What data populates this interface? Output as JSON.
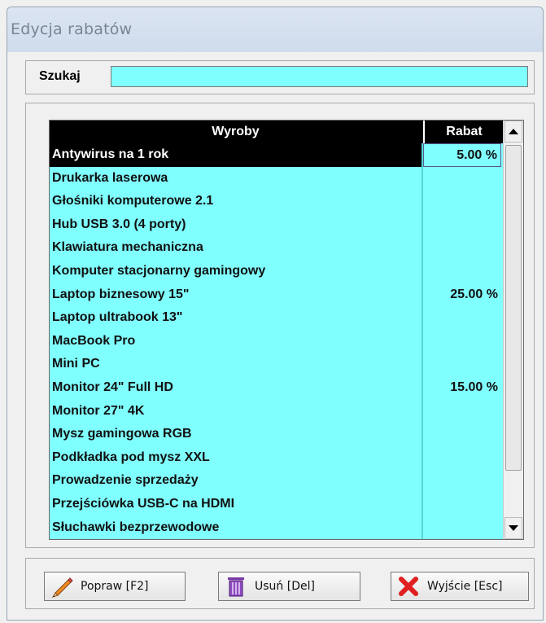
{
  "window": {
    "title": "Edycja rabatów"
  },
  "search": {
    "label": "Szukaj",
    "value": "",
    "placeholder": ""
  },
  "grid": {
    "columns": {
      "name": "Wyroby",
      "discount": "Rabat"
    },
    "selected_index": 0,
    "rows": [
      {
        "name": "Antywirus na 1 rok",
        "discount": "5.00 %"
      },
      {
        "name": "Drukarka laserowa",
        "discount": ""
      },
      {
        "name": "Głośniki komputerowe 2.1",
        "discount": ""
      },
      {
        "name": "Hub USB 3.0 (4 porty)",
        "discount": ""
      },
      {
        "name": "Klawiatura mechaniczna",
        "discount": ""
      },
      {
        "name": "Komputer stacjonarny gamingowy",
        "discount": ""
      },
      {
        "name": "Laptop biznesowy 15\"",
        "discount": "25.00 %"
      },
      {
        "name": "Laptop ultrabook 13\"",
        "discount": ""
      },
      {
        "name": "MacBook Pro",
        "discount": ""
      },
      {
        "name": "Mini PC",
        "discount": ""
      },
      {
        "name": "Monitor 24\" Full HD",
        "discount": "15.00 %"
      },
      {
        "name": "Monitor 27\" 4K",
        "discount": ""
      },
      {
        "name": "Mysz gamingowa RGB",
        "discount": ""
      },
      {
        "name": "Podkładka pod mysz XXL",
        "discount": ""
      },
      {
        "name": "Prowadzenie sprzedaży",
        "discount": ""
      },
      {
        "name": "Przejściówka USB-C na HDMI",
        "discount": ""
      },
      {
        "name": "Słuchawki bezprzewodowe",
        "discount": ""
      }
    ]
  },
  "buttons": {
    "edit": {
      "label": "Popraw   [F2]",
      "icon": "pencil-icon"
    },
    "delete": {
      "label": "Usuń   [Del]",
      "icon": "trash-icon"
    },
    "exit": {
      "label": "Wyjście  [Esc]",
      "icon": "red-x-icon"
    }
  },
  "colors": {
    "field_bg": "#80ffff",
    "header_bg": "#000000",
    "exit_icon": "#e02020",
    "trash_icon": "#7a3aa8"
  }
}
